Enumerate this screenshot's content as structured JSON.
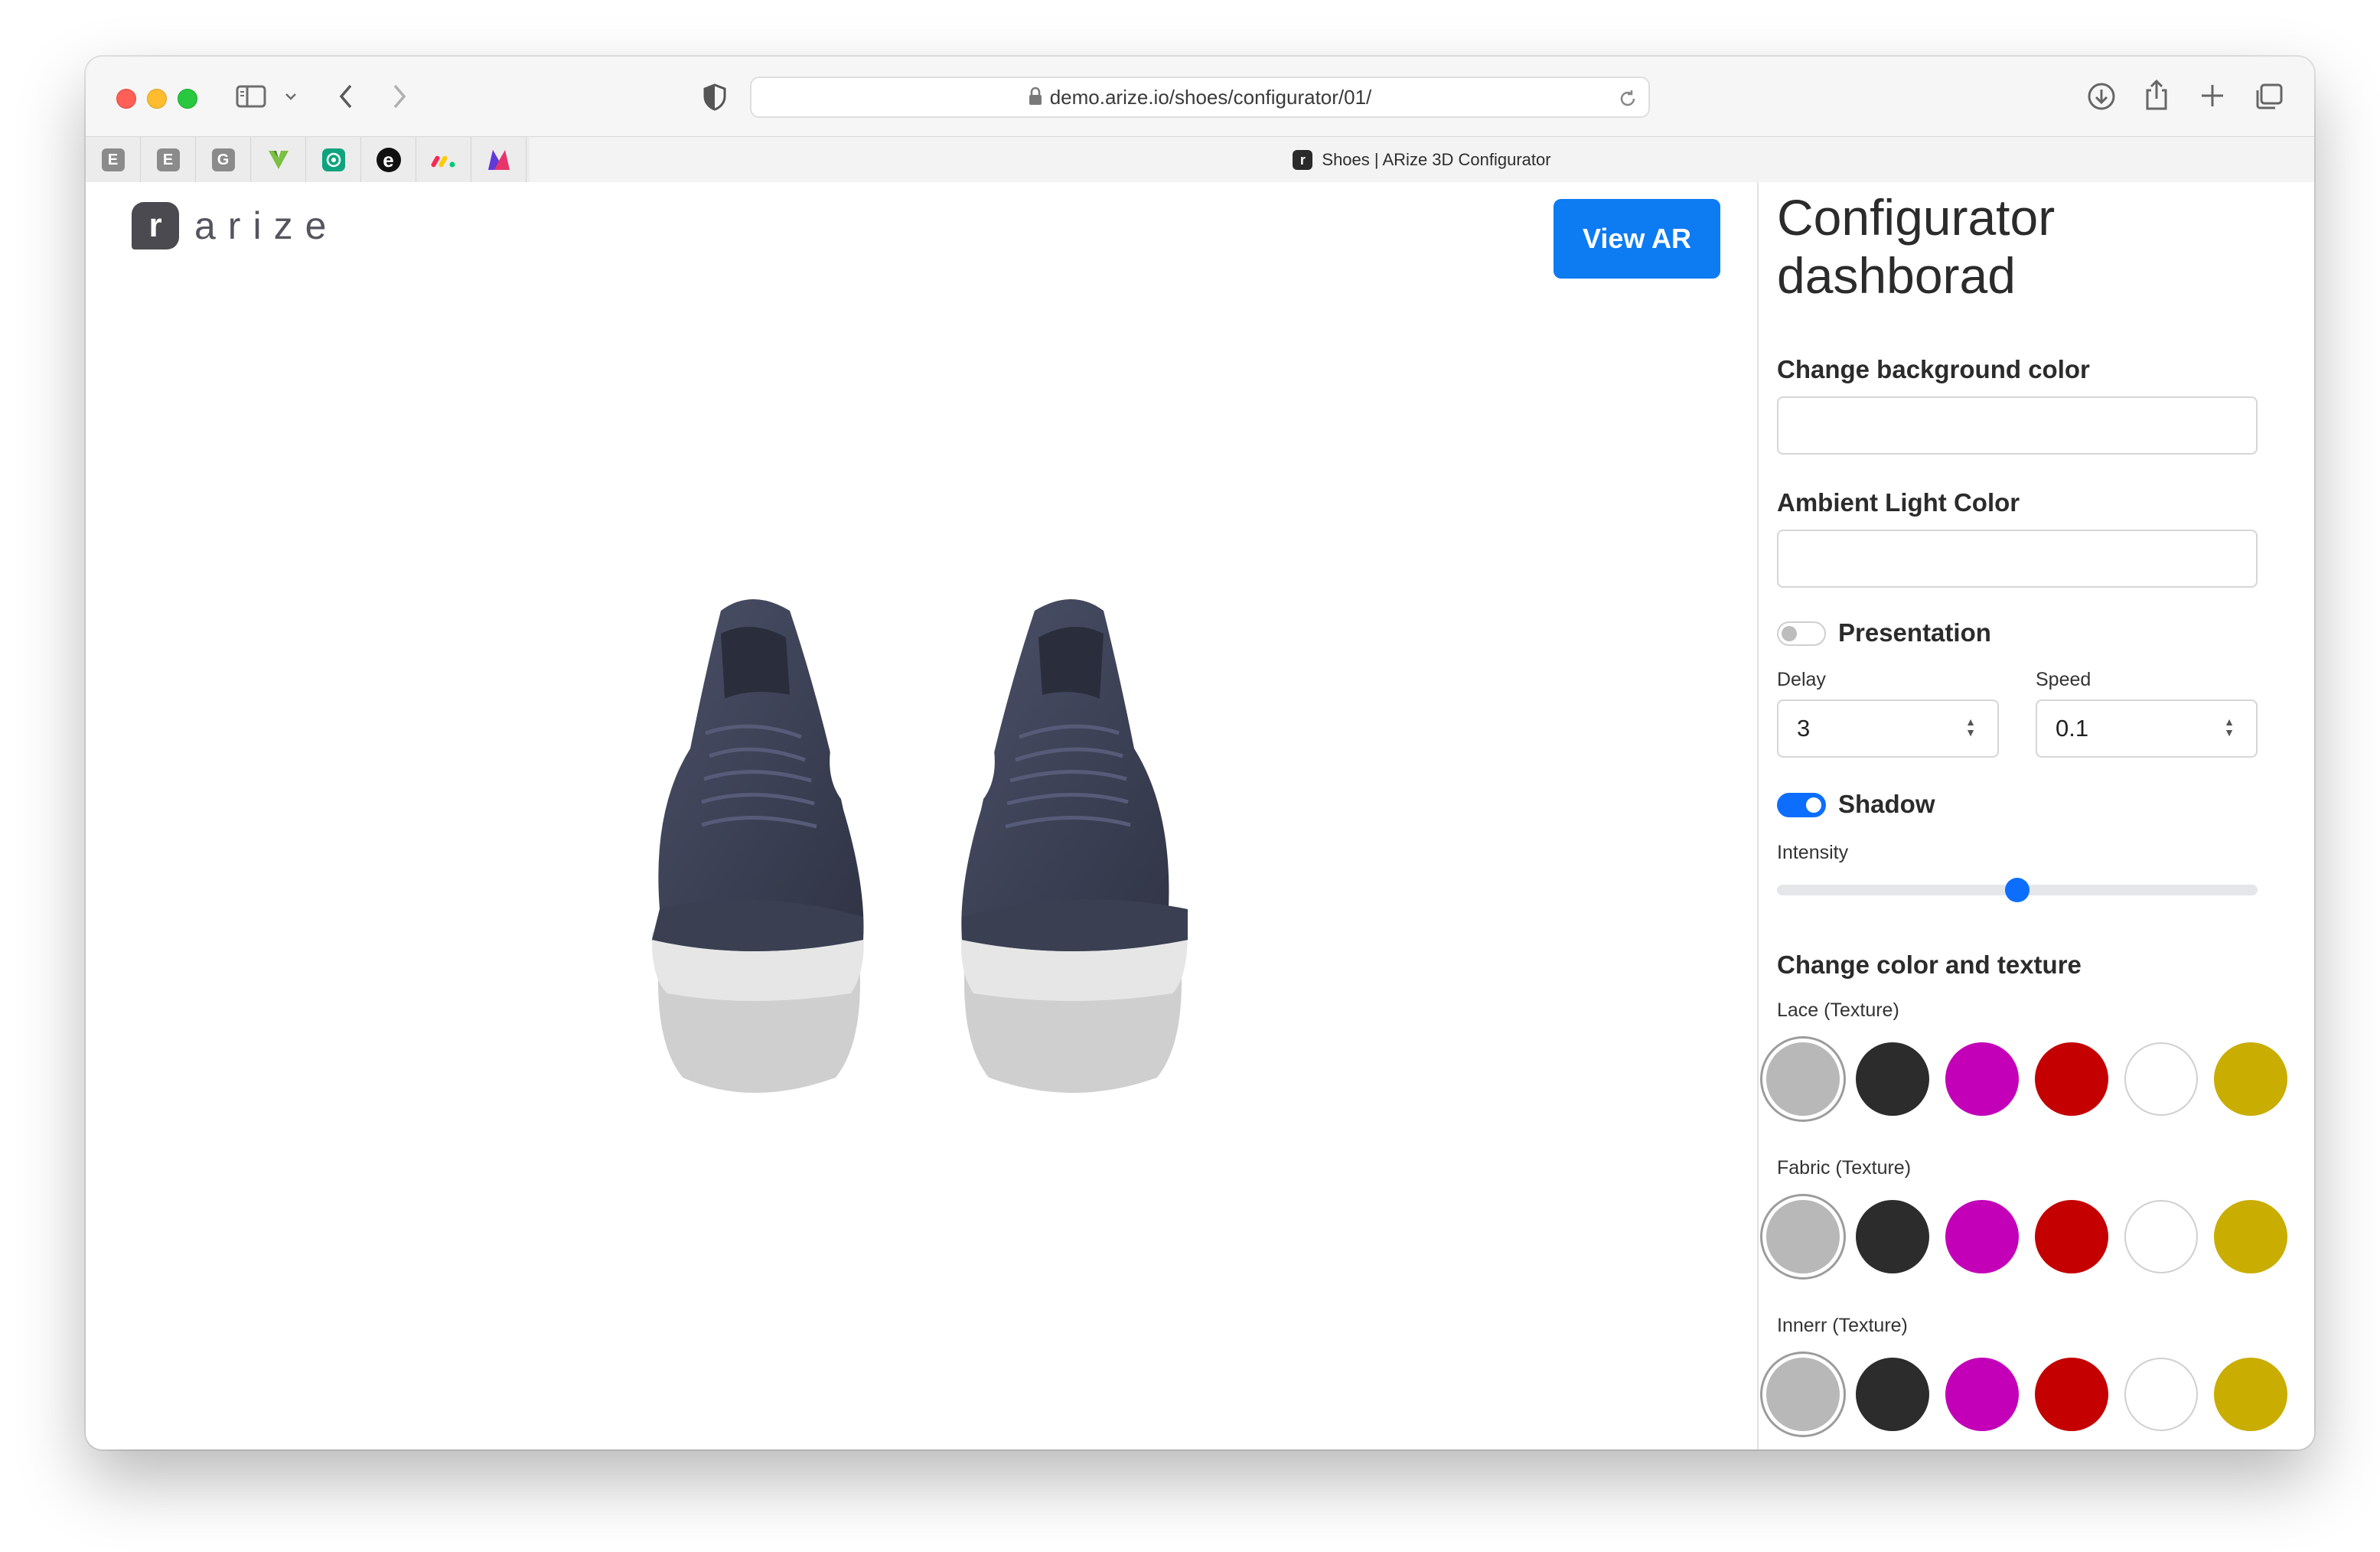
{
  "browser": {
    "url": "demo.arize.io/shoes/configurator/01/",
    "tab_title": "Shoes | ARize 3D Configurator",
    "favicons": [
      {
        "name": "e1",
        "glyph": "E"
      },
      {
        "name": "e2",
        "glyph": "E"
      },
      {
        "name": "g",
        "glyph": "G"
      },
      {
        "name": "v",
        "glyph": ""
      },
      {
        "name": "openai",
        "glyph": ""
      },
      {
        "name": "e3",
        "glyph": "e"
      },
      {
        "name": "monday",
        "glyph": ""
      },
      {
        "name": "m",
        "glyph": ""
      }
    ]
  },
  "header": {
    "logo_mark": "r",
    "logo_text": "arize",
    "view_ar_label": "View AR"
  },
  "dashboard": {
    "title": "Configurator dashborad",
    "bg_color_label": "Change background color",
    "ambient_label": "Ambient Light Color",
    "presentation_label": "Presentation",
    "presentation_on": false,
    "delay_label": "Delay",
    "delay_value": "3",
    "speed_label": "Speed",
    "speed_value": "0.1",
    "shadow_label": "Shadow",
    "shadow_on": true,
    "intensity_label": "Intensity",
    "intensity_value": 0.5,
    "texture_title": "Change color and texture",
    "texture_groups": [
      {
        "label": "Lace (Texture)"
      },
      {
        "label": "Fabric (Texture)"
      },
      {
        "label": "Innerr (Texture)"
      }
    ],
    "swatch_colors": [
      "#b8b8b8",
      "#2c2c2c",
      "#c300b8",
      "#c40000",
      "#ffffff",
      "#c9ad00"
    ],
    "selected_swatch": 0
  },
  "colors": {
    "accent": "#0d7bf2",
    "shoe_upper": "#3e4356",
    "sole": "#d8d8d8"
  }
}
